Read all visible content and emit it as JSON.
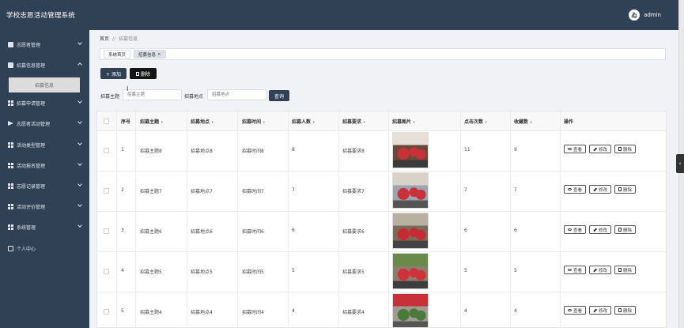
{
  "app": {
    "title": "学校志愿活动管理系统",
    "user": "admin",
    "avatar_letter": "ゐ"
  },
  "sidebar": {
    "items": [
      {
        "label": "志愿者管理",
        "icon": "square-icon"
      },
      {
        "label": "招募信息管理",
        "icon": "document-icon"
      },
      {
        "label": "招募申请管理",
        "icon": "grid-icon"
      },
      {
        "label": "志愿者活动管理",
        "icon": "send-icon"
      },
      {
        "label": "活动类型管理",
        "icon": "grid-icon"
      },
      {
        "label": "活动报名管理",
        "icon": "grid-icon"
      },
      {
        "label": "志愿记录管理",
        "icon": "grid-icon"
      },
      {
        "label": "活动评价管理",
        "icon": "grid-icon"
      },
      {
        "label": "系统管理",
        "icon": "grid-icon"
      },
      {
        "label": "个人中心",
        "icon": "user-icon"
      }
    ],
    "submenu": {
      "label": "招募信息"
    }
  },
  "breadcrumb": {
    "home": "首页",
    "separator": "//",
    "current": "招募信息"
  },
  "tabs": [
    {
      "label": "系统首页"
    },
    {
      "label": "招募信息",
      "close": "×"
    }
  ],
  "actions": {
    "add": "+ 添加",
    "delete": "删除"
  },
  "search": {
    "theme_label": "招募主题",
    "theme_placeholder": "招募主题",
    "location_label": "招募地点",
    "location_placeholder": "招募地点",
    "button": "查询"
  },
  "table": {
    "headers": [
      "序号",
      "招募主题",
      "招募地点",
      "招募时间",
      "招募人数",
      "招募要求",
      "招募图片",
      "点击次数",
      "收藏数",
      "操作"
    ],
    "sort_glyph": "⇕",
    "ops": {
      "view": "查看",
      "edit": "修改",
      "delete": "删除"
    },
    "rows": [
      {
        "idx": "1",
        "theme": "招募主题8",
        "location": "招募地点8",
        "time": "招募时间8",
        "count": "8",
        "req": "招募要求8",
        "clicks": "11",
        "favs": "9"
      },
      {
        "idx": "2",
        "theme": "招募主题7",
        "location": "招募地点7",
        "time": "招募时间7",
        "count": "7",
        "req": "招募要求7",
        "clicks": "7",
        "favs": "7"
      },
      {
        "idx": "3",
        "theme": "招募主题6",
        "location": "招募地点6",
        "time": "招募时间6",
        "count": "6",
        "req": "招募要求6",
        "clicks": "6",
        "favs": "6"
      },
      {
        "idx": "4",
        "theme": "招募主题5",
        "location": "招募地点5",
        "time": "招募时间5",
        "count": "5",
        "req": "招募要求5",
        "clicks": "5",
        "favs": "5"
      },
      {
        "idx": "5",
        "theme": "招募主题4",
        "location": "招募地点4",
        "time": "招募时间4",
        "count": "4",
        "req": "招募要求4",
        "clicks": "4",
        "favs": "4"
      }
    ]
  },
  "colors": {
    "nav": "#304156",
    "accent": "#304156",
    "danger_btn": "#151515"
  }
}
